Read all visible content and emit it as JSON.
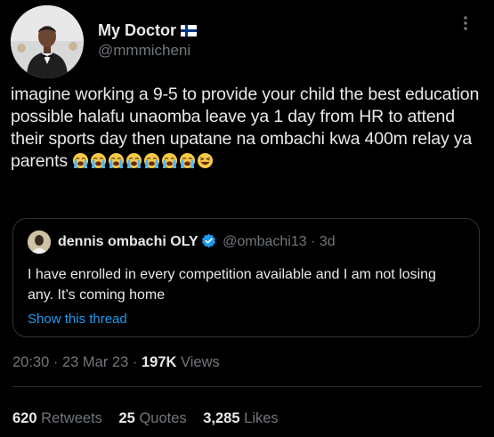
{
  "tweet": {
    "author": {
      "display_name": "My Doctor",
      "flag_icon": "finland-flag-icon",
      "handle": "@mmmicheni"
    },
    "text": "imagine working a 9-5 to provide your child the best education possible halafu unaomba leave ya 1 day from HR to attend their sports day then upatane na ombachi kwa 400m relay ya parents",
    "emojis": [
      "loudly-crying-face",
      "loudly-crying-face",
      "loudly-crying-face",
      "loudly-crying-face",
      "loudly-crying-face",
      "loudly-crying-face",
      "loudly-crying-face",
      "grinning-squinting-face"
    ],
    "quote": {
      "author_name": "dennis ombachi OLY",
      "verified_icon": "verified-badge-icon",
      "handle": "@ombachi13",
      "separator": "·",
      "time": "3d",
      "text": "I have enrolled in every competition available and I am not losing any. It’s coming home",
      "show_thread": "Show this thread"
    },
    "meta": {
      "time": "20:30",
      "separator": "·",
      "date": "23 Mar 23",
      "views_count": "197K",
      "views_label": "Views"
    },
    "stats": {
      "retweets_count": "620",
      "retweets_label": "Retweets",
      "quotes_count": "25",
      "quotes_label": "Quotes",
      "likes_count": "3,285",
      "likes_label": "Likes"
    }
  },
  "colors": {
    "background": "#000000",
    "text": "#e7e9ea",
    "muted": "#71767b",
    "border": "#2f3336",
    "accent": "#1d9bf0"
  }
}
